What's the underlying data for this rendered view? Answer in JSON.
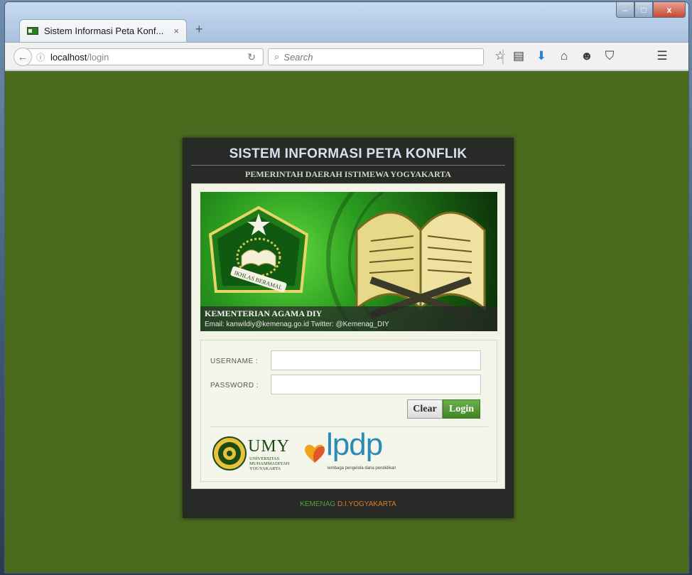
{
  "browser": {
    "tab_title": "Sistem Informasi Peta Konf...",
    "tab_close": "×",
    "new_tab": "+",
    "url_host": "localhost",
    "url_path": "/login",
    "search_placeholder": "Search",
    "window_controls": {
      "minimize": "–",
      "maximize": "□",
      "close": "x"
    }
  },
  "page": {
    "title": "SISTEM INFORMASI PETA KONFLIK",
    "subtitle": "PEMERINTAH DAERAH ISTIMEWA YOGYAKARTA",
    "banner": {
      "caption_title": "KEMENTERIAN AGAMA DIY",
      "caption_text": "Email: kanwildiy@kemenag.go.id Twitter: @Kemenag_DIY",
      "seal_text": "IKHLAS BERAMAL"
    },
    "form": {
      "username_label": "USERNAME :",
      "password_label": "PASSWORD :",
      "username_value": "",
      "password_value": "",
      "clear_label": "Clear",
      "login_label": "Login"
    },
    "logos": {
      "umy_name": "UMY",
      "umy_sub": [
        "UNIVERSITAS",
        "MUHAMMADIYAH",
        "YOGYAKARTA"
      ],
      "lpdp_name": "lpdp",
      "lpdp_sub": "lembaga pengelola dana pendidikan"
    },
    "footer": {
      "part1": "KEMENAG",
      "part2": " D.I.YOGYAKARTA"
    }
  },
  "colors": {
    "page_bg": "#4a6b1e",
    "panel_bg": "#272a27",
    "login_btn": "#4f9a34",
    "footer_green": "#4fa13a",
    "footer_orange": "#e07b24"
  }
}
